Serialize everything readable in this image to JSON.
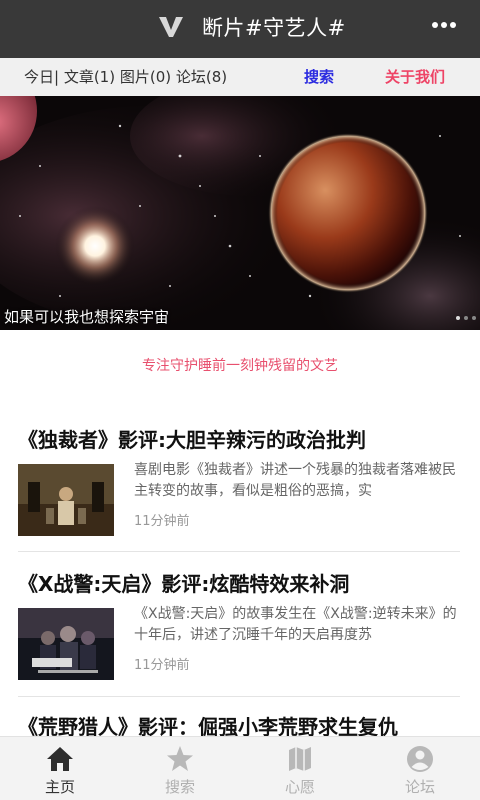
{
  "header": {
    "title": "断片#守艺人#",
    "logo_icon": "v-logo-icon",
    "more_icon": "more-dots-icon"
  },
  "subnav": {
    "counts": "今日| 文章(1)  图片(0) 论坛(8)",
    "search": "搜索",
    "about": "关于我们"
  },
  "banner": {
    "caption": "如果可以我也想探索宇宙",
    "slide_count": 3,
    "active_slide": 1
  },
  "tagline": "专注守护睡前一刻钟残留的文艺",
  "articles": [
    {
      "title": "《独裁者》影评:大胆辛辣污的政治批判",
      "excerpt": "喜剧电影《独裁者》讲述一个残暴的独裁者落难被民主转变的故事，看似是粗俗的恶搞，实",
      "time": "11分钟前"
    },
    {
      "title": "《X战警:天启》影评:炫酷特效来补洞",
      "excerpt": "《X战警:天启》的故事发生在《X战警:逆转未来》的十年后，讲述了沉睡千年的天启再度苏",
      "time": "11分钟前"
    },
    {
      "title": "《荒野猎人》影评：倔强小李荒野求生复仇",
      "excerpt": "",
      "time": ""
    }
  ],
  "tabs": [
    {
      "label": "主页",
      "icon": "home-icon",
      "active": true
    },
    {
      "label": "搜索",
      "icon": "star-icon",
      "active": false
    },
    {
      "label": "心愿",
      "icon": "map-icon",
      "active": false
    },
    {
      "label": "论坛",
      "icon": "user-icon",
      "active": false
    }
  ],
  "colors": {
    "topbar": "#393939",
    "subnav_bg": "#f0f0f0",
    "search_link": "#2b2be0",
    "about_link": "#ee4466",
    "tagline": "#e8506e"
  }
}
